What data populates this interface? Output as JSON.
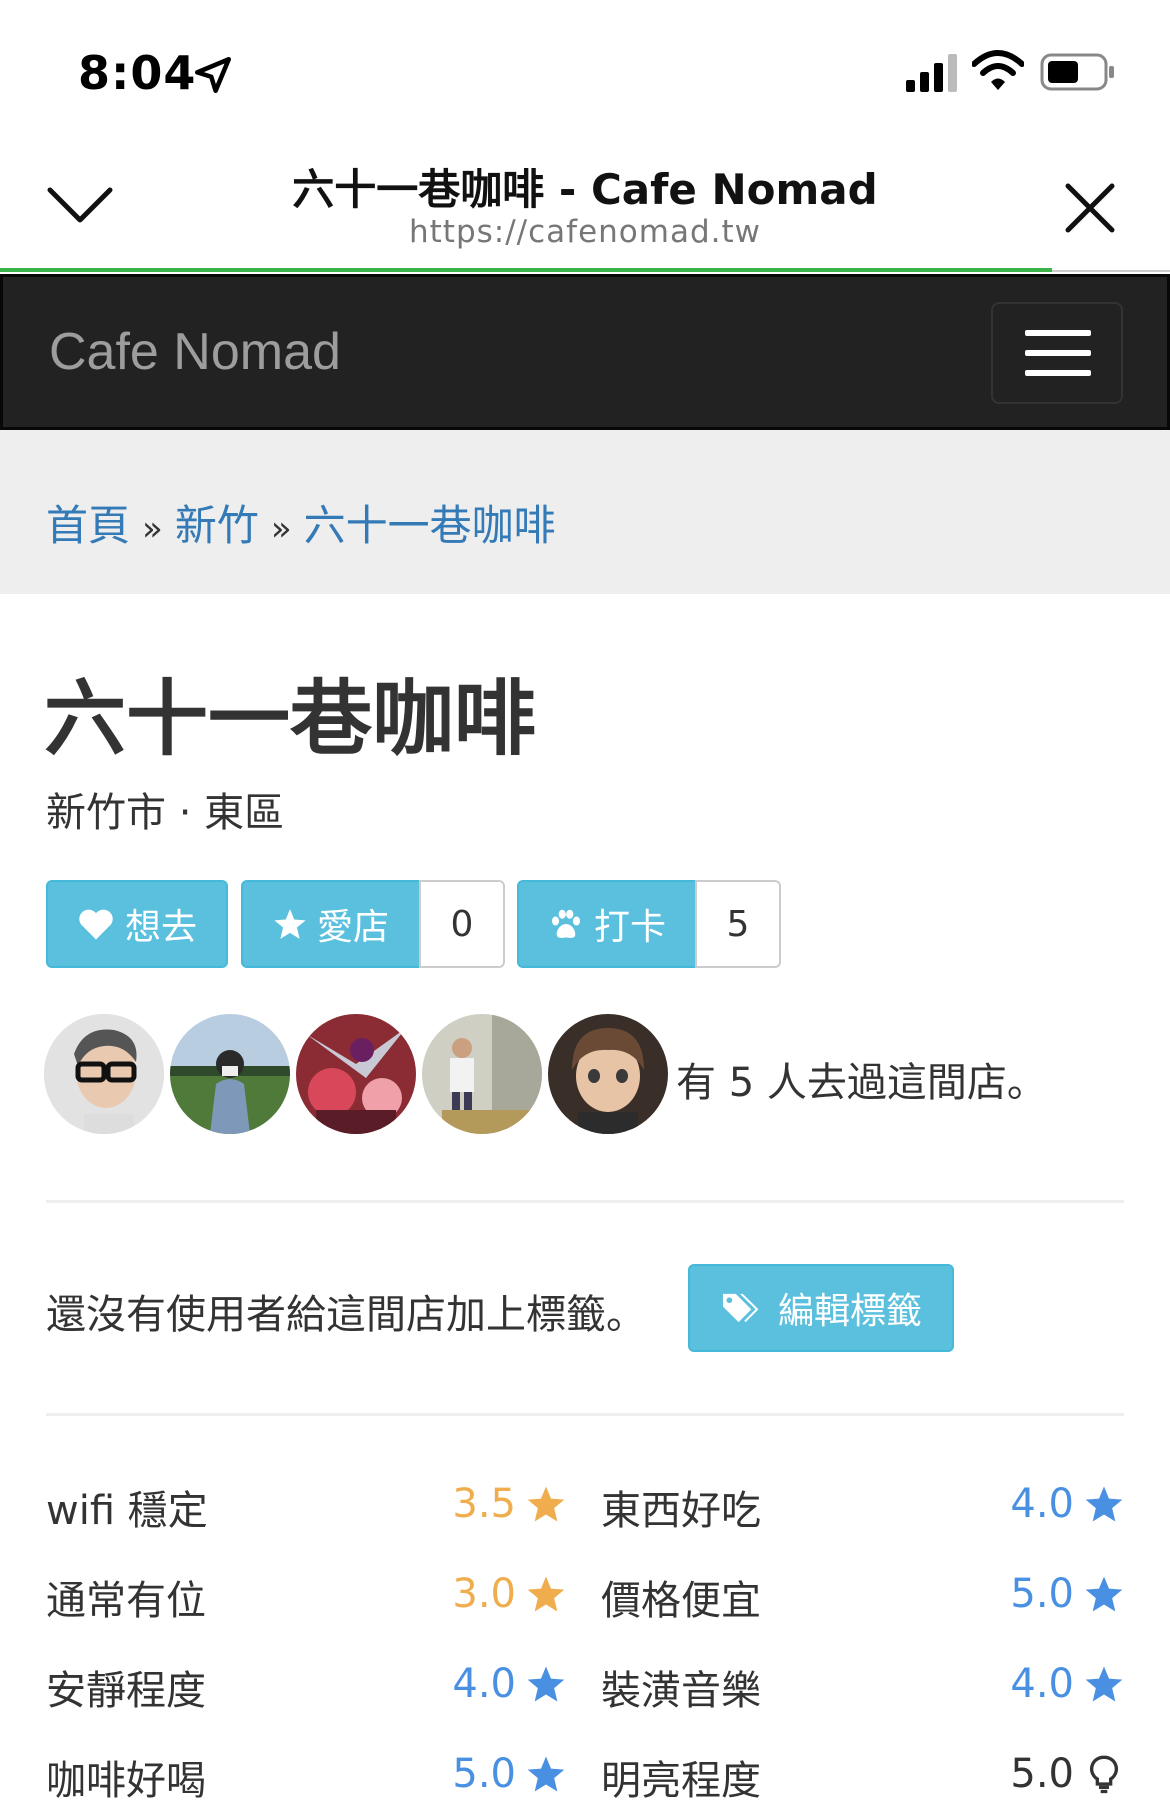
{
  "status": {
    "time": "8:04"
  },
  "browser": {
    "title": "六十一巷咖啡 - Cafe Nomad",
    "url": "https://cafenomad.tw"
  },
  "navbar": {
    "brand": "Cafe Nomad"
  },
  "breadcrumb": {
    "items": [
      "首頁",
      "新竹",
      "六十一巷咖啡"
    ],
    "separator": "»"
  },
  "shop": {
    "name": "六十一巷咖啡",
    "location": "新竹市 · 東區"
  },
  "actions": {
    "want_label": "想去",
    "fav_label": "愛店",
    "fav_count": "0",
    "checkin_label": "打卡",
    "checkin_count": "5"
  },
  "visitors": {
    "text": "有 5 人去過這間店。"
  },
  "tags": {
    "empty_text": "還沒有使用者給這間店加上標籤。",
    "edit_label": "編輯標籤"
  },
  "ratings": [
    {
      "label": "wifi 穩定",
      "value": "3.5",
      "icon": "star-icon",
      "color": "#f0ad4e"
    },
    {
      "label": "東西好吃",
      "value": "4.0",
      "icon": "star-icon",
      "color": "#4a90e2"
    },
    {
      "label": "通常有位",
      "value": "3.0",
      "icon": "star-icon",
      "color": "#f0ad4e"
    },
    {
      "label": "價格便宜",
      "value": "5.0",
      "icon": "star-icon",
      "color": "#4a90e2"
    },
    {
      "label": "安靜程度",
      "value": "4.0",
      "icon": "star-icon",
      "color": "#4a90e2"
    },
    {
      "label": "裝潢音樂",
      "value": "4.0",
      "icon": "star-icon",
      "color": "#4a90e2"
    },
    {
      "label": "咖啡好喝",
      "value": "5.0",
      "icon": "star-icon",
      "color": "#4a90e2"
    },
    {
      "label": "明亮程度",
      "value": "5.0",
      "icon": "lightbulb-icon",
      "color": "#333333"
    }
  ]
}
